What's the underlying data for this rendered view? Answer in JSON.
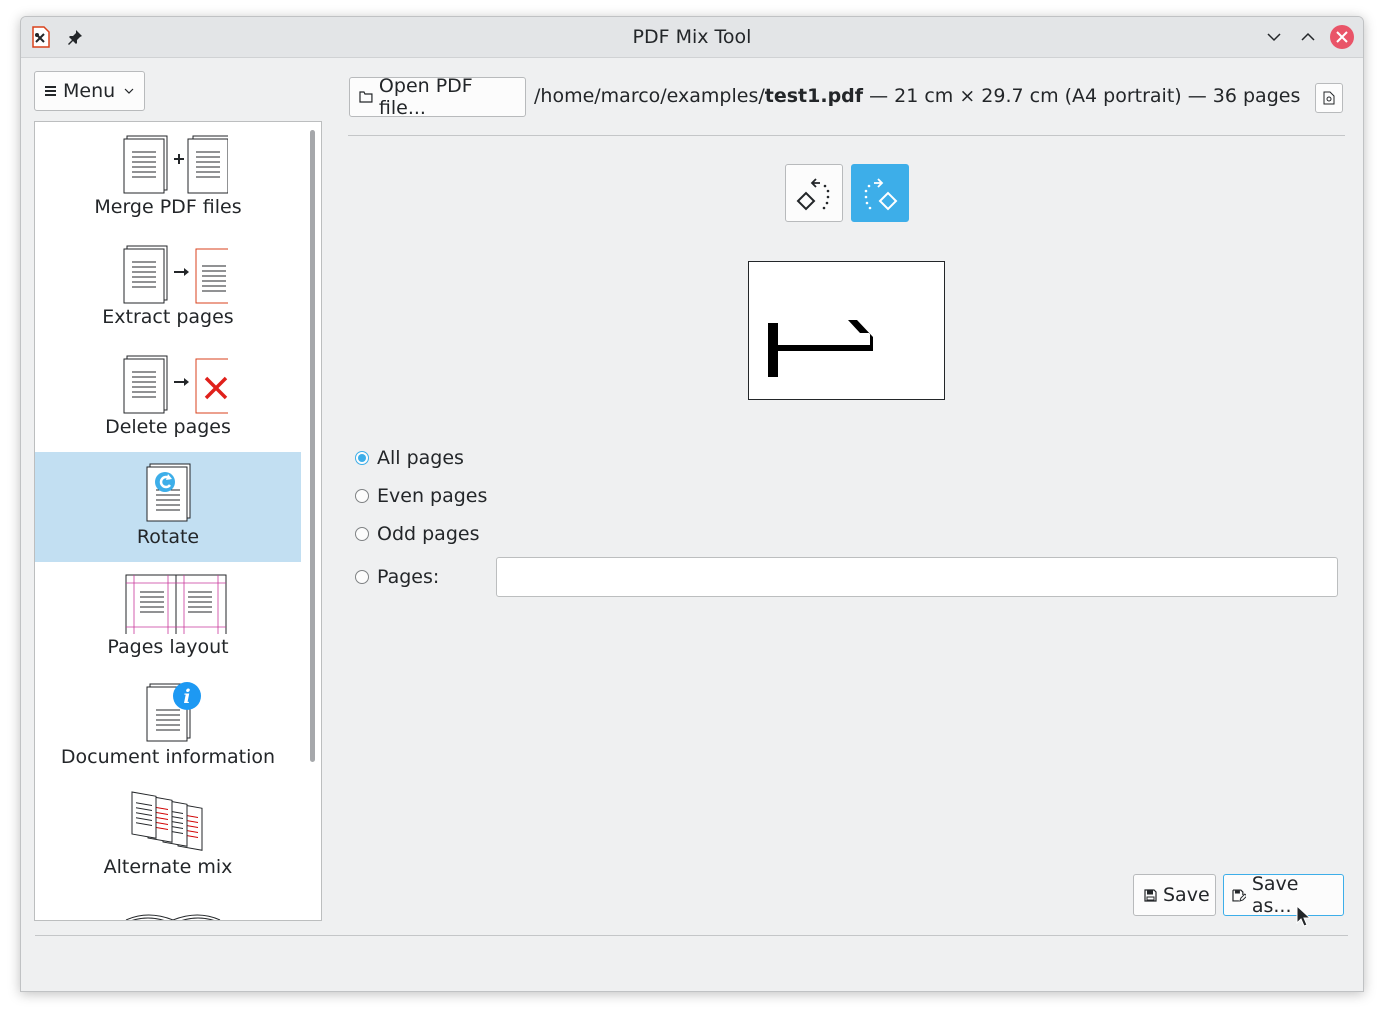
{
  "window": {
    "title": "PDF Mix Tool"
  },
  "menu": {
    "label": "Menu"
  },
  "sidebar": {
    "items": [
      {
        "label": "Merge PDF files",
        "icon": "merge-pdf-icon"
      },
      {
        "label": "Extract pages",
        "icon": "extract-pages-icon"
      },
      {
        "label": "Delete pages",
        "icon": "delete-pages-icon"
      },
      {
        "label": "Rotate",
        "icon": "rotate-icon",
        "selected": true
      },
      {
        "label": "Pages layout",
        "icon": "pages-layout-icon"
      },
      {
        "label": "Document information",
        "icon": "document-information-icon"
      },
      {
        "label": "Alternate mix",
        "icon": "alternate-mix-icon"
      }
    ]
  },
  "toolbar": {
    "open_label": "Open PDF file...",
    "path_prefix": "/home/marco/examples/",
    "file_name": "test1.pdf",
    "file_details": " — 21 cm × 29.7 cm (A4 portrait) — 36 pages"
  },
  "rotation": {
    "left_icon": "rotate-left-icon",
    "right_icon": "rotate-right-icon",
    "selected": "right"
  },
  "options": {
    "all_pages": "All pages",
    "even_pages": "Even pages",
    "odd_pages": "Odd pages",
    "pages": "Pages:",
    "selected": "all_pages",
    "pages_value": ""
  },
  "actions": {
    "save_label": "Save",
    "save_as_label": "Save as..."
  },
  "colors": {
    "accent": "#3daee9",
    "selection": "#c2dff2",
    "close": "#e95468"
  }
}
